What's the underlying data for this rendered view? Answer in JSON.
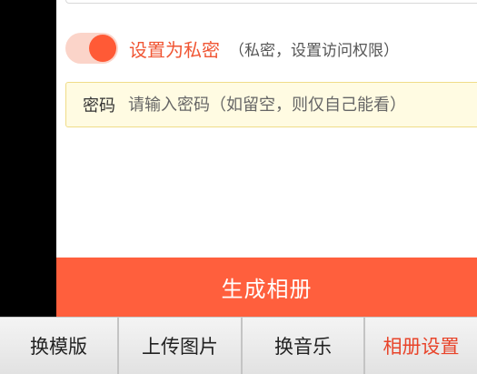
{
  "privacy": {
    "label": "设置为私密",
    "hint": "（私密，设置访问权限）",
    "toggle_on": true
  },
  "password": {
    "label": "密码",
    "placeholder": "请输入密码（如留空，则仅自己能看）",
    "value": ""
  },
  "generate_button": "生成相册",
  "bottom_tabs": [
    {
      "label": "换模版",
      "active": false
    },
    {
      "label": "上传图片",
      "active": false
    },
    {
      "label": "换音乐",
      "active": false
    },
    {
      "label": "相册设置",
      "active": true
    }
  ],
  "colors": {
    "accent": "#ff5f3d",
    "toggle_track": "#fbd4c9",
    "password_bg": "#fffbe2"
  }
}
